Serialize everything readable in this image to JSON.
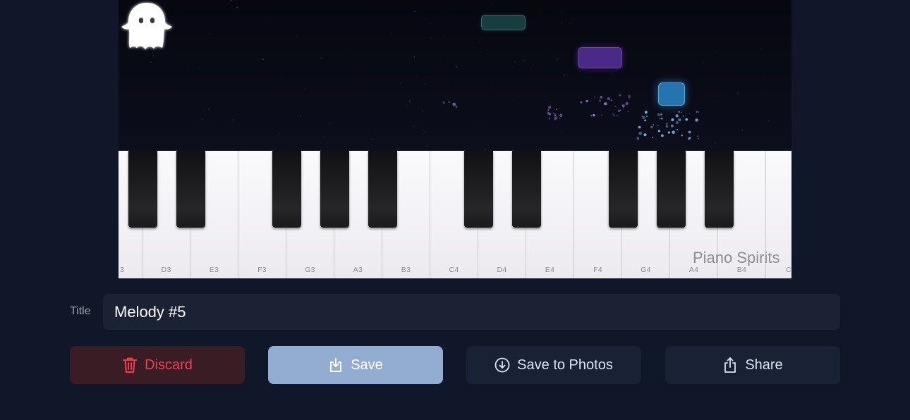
{
  "brand": "Piano Spirits",
  "piano": {
    "white_key_labels": [
      "3",
      "D3",
      "E3",
      "F3",
      "G3",
      "A3",
      "B3",
      "C4",
      "D4",
      "E4",
      "F4",
      "G4",
      "A4",
      "B4",
      "C"
    ]
  },
  "stage": {
    "note_colors": {
      "teal": "#173d3f",
      "purple": "#4a2a86",
      "blue": "#2474b0"
    }
  },
  "form": {
    "title_label": "Title",
    "title_value": "Melody #5"
  },
  "actions": {
    "discard_label": "Discard",
    "save_label": "Save",
    "save_photos_label": "Save to Photos",
    "share_label": "Share"
  },
  "icons": {
    "discard": "trash-icon",
    "save": "save-download-icon",
    "save_photos": "arrow-down-circle-icon",
    "share": "share-icon"
  },
  "colors": {
    "background": "#0f1728",
    "discard_text": "#f0414c",
    "save_bg": "#93acd2"
  }
}
